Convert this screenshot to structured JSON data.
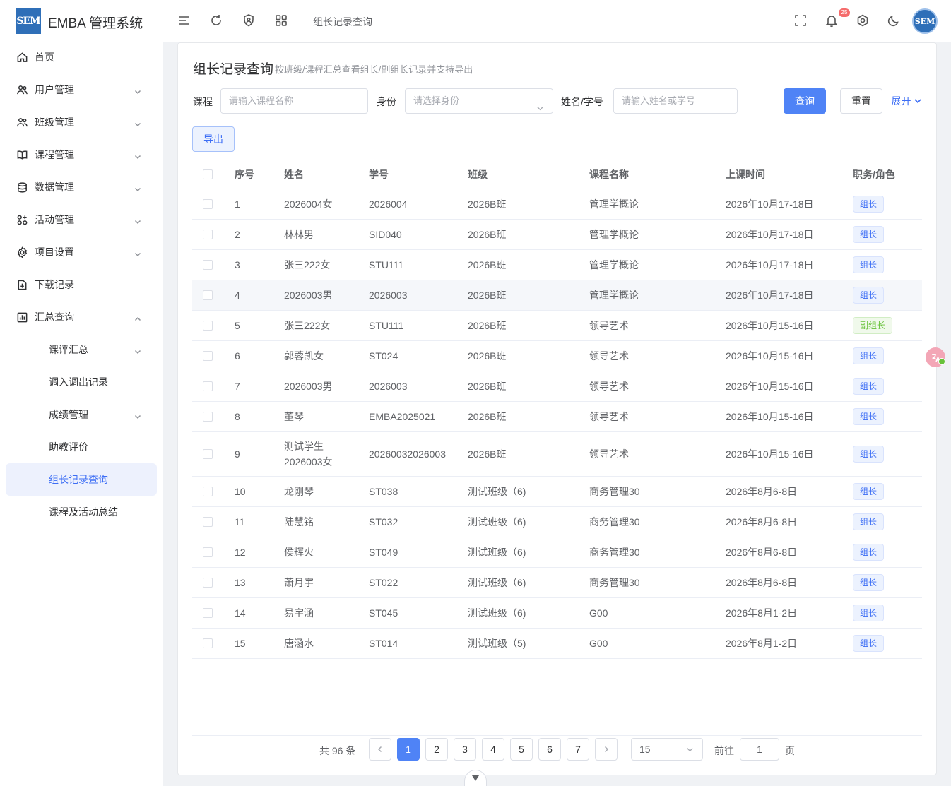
{
  "app": {
    "logo_text": "SEM",
    "title": "EMBA 管理系统"
  },
  "sidebar": {
    "items": [
      {
        "label": "首页",
        "icon": "home-icon",
        "has_arrow": false
      },
      {
        "label": "用户管理",
        "icon": "users-icon",
        "has_arrow": true
      },
      {
        "label": "班级管理",
        "icon": "users-icon",
        "has_arrow": true
      },
      {
        "label": "课程管理",
        "icon": "book-icon",
        "has_arrow": true
      },
      {
        "label": "数据管理",
        "icon": "database-icon",
        "has_arrow": true
      },
      {
        "label": "活动管理",
        "icon": "grid-plus-icon",
        "has_arrow": true
      },
      {
        "label": "项目设置",
        "icon": "gear-icon",
        "has_arrow": true
      },
      {
        "label": "下载记录",
        "icon": "download-icon",
        "has_arrow": false
      },
      {
        "label": "汇总查询",
        "icon": "chart-icon",
        "has_arrow": true,
        "expanded": true
      }
    ],
    "subitems": [
      {
        "label": "课评汇总",
        "has_arrow": true
      },
      {
        "label": "调入调出记录",
        "has_arrow": false
      },
      {
        "label": "成绩管理",
        "has_arrow": true
      },
      {
        "label": "助教评价",
        "has_arrow": false
      },
      {
        "label": "组长记录查询",
        "has_arrow": false,
        "active": true
      },
      {
        "label": "课程及活动总结",
        "has_arrow": false
      }
    ]
  },
  "topbar": {
    "breadcrumb": "组长记录查询",
    "notification_count": "25",
    "avatar_text": "SEM"
  },
  "page": {
    "title": "组长记录查询",
    "subtitle": "按班级/课程汇总查看组长/副组长记录并支持导出"
  },
  "filters": {
    "course_label": "课程",
    "course_placeholder": "请输入课程名称",
    "role_label": "身份",
    "role_placeholder": "请选择身份",
    "name_label": "姓名/学号",
    "name_placeholder": "请输入姓名或学号",
    "search_button": "查询",
    "reset_button": "重置",
    "expand_button": "展开",
    "export_button": "导出"
  },
  "table": {
    "columns": [
      "序号",
      "姓名",
      "学号",
      "班级",
      "课程名称",
      "上课时间",
      "职务/角色"
    ],
    "rows": [
      {
        "no": "1",
        "name": "2026004女",
        "sid": "2026004",
        "class": "2026B班",
        "course": "管理学概论",
        "time": "2026年10月17-18日",
        "role": "组长",
        "role_type": "leader"
      },
      {
        "no": "2",
        "name": "林林男",
        "sid": "SID040",
        "class": "2026B班",
        "course": "管理学概论",
        "time": "2026年10月17-18日",
        "role": "组长",
        "role_type": "leader"
      },
      {
        "no": "3",
        "name": "张三222女",
        "sid": "STU111",
        "class": "2026B班",
        "course": "管理学概论",
        "time": "2026年10月17-18日",
        "role": "组长",
        "role_type": "leader"
      },
      {
        "no": "4",
        "name": "2026003男",
        "sid": "2026003",
        "class": "2026B班",
        "course": "管理学概论",
        "time": "2026年10月17-18日",
        "role": "组长",
        "role_type": "leader"
      },
      {
        "no": "5",
        "name": "张三222女",
        "sid": "STU111",
        "class": "2026B班",
        "course": "领导艺术",
        "time": "2026年10月15-16日",
        "role": "副组长",
        "role_type": "deputy"
      },
      {
        "no": "6",
        "name": "郭蓉凯女",
        "sid": "ST024",
        "class": "2026B班",
        "course": "领导艺术",
        "time": "2026年10月15-16日",
        "role": "组长",
        "role_type": "leader"
      },
      {
        "no": "7",
        "name": "2026003男",
        "sid": "2026003",
        "class": "2026B班",
        "course": "领导艺术",
        "time": "2026年10月15-16日",
        "role": "组长",
        "role_type": "leader"
      },
      {
        "no": "8",
        "name": "董琴",
        "sid": "EMBA2025021",
        "class": "2026B班",
        "course": "领导艺术",
        "time": "2026年10月15-16日",
        "role": "组长",
        "role_type": "leader"
      },
      {
        "no": "9",
        "name": "测试学生2026003女",
        "sid": "20260032026003",
        "class": "2026B班",
        "course": "领导艺术",
        "time": "2026年10月15-16日",
        "role": "组长",
        "role_type": "leader"
      },
      {
        "no": "10",
        "name": "龙刚琴",
        "sid": "ST038",
        "class": "测试班级（6)",
        "course": "商务管理30",
        "time": "2026年8月6-8日",
        "role": "组长",
        "role_type": "leader"
      },
      {
        "no": "11",
        "name": "陆慧铭",
        "sid": "ST032",
        "class": "测试班级（6)",
        "course": "商务管理30",
        "time": "2026年8月6-8日",
        "role": "组长",
        "role_type": "leader"
      },
      {
        "no": "12",
        "name": "侯辉火",
        "sid": "ST049",
        "class": "测试班级（6)",
        "course": "商务管理30",
        "time": "2026年8月6-8日",
        "role": "组长",
        "role_type": "leader"
      },
      {
        "no": "13",
        "name": "萧月宇",
        "sid": "ST022",
        "class": "测试班级（6)",
        "course": "商务管理30",
        "time": "2026年8月6-8日",
        "role": "组长",
        "role_type": "leader"
      },
      {
        "no": "14",
        "name": "易宇涵",
        "sid": "ST045",
        "class": "测试班级（6)",
        "course": "G00",
        "time": "2026年8月1-2日",
        "role": "组长",
        "role_type": "leader"
      },
      {
        "no": "15",
        "name": "唐涵水",
        "sid": "ST014",
        "class": "测试班级（5)",
        "course": "G00",
        "time": "2026年8月1-2日",
        "role": "组长",
        "role_type": "leader"
      }
    ]
  },
  "pagination": {
    "total_text": "共 96 条",
    "pages": [
      "1",
      "2",
      "3",
      "4",
      "5",
      "6",
      "7"
    ],
    "current": "1",
    "page_size": "15",
    "goto_label": "前往",
    "goto_value": "1",
    "page_suffix": "页"
  },
  "colors": {
    "primary": "#4f83f6",
    "active_text": "#3d6ef5",
    "deputy_tag": "#67c23a"
  }
}
